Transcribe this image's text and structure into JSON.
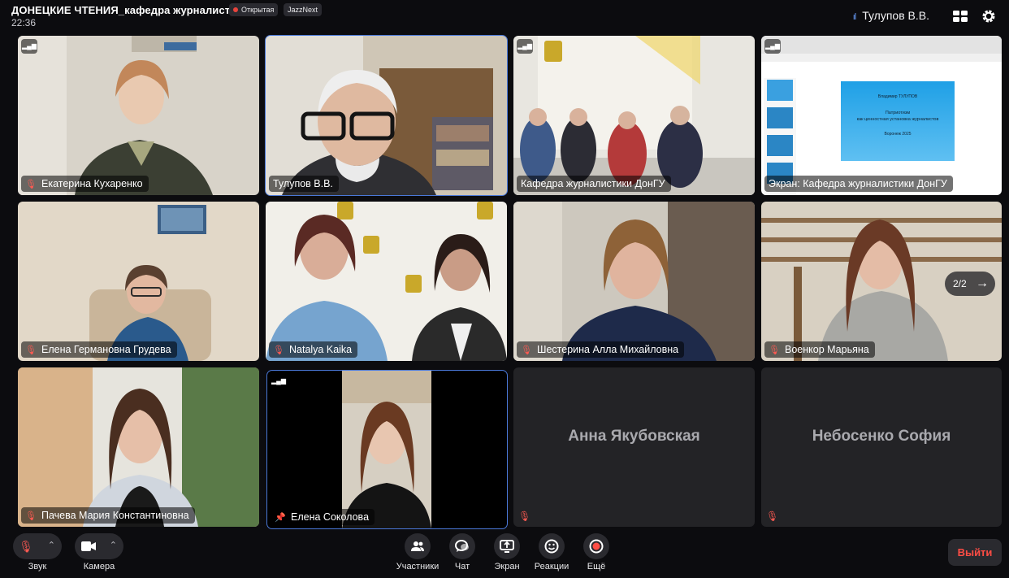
{
  "header": {
    "title": "ДОНЕЦКИЕ ЧТЕНИЯ_кафедра журналистики",
    "time": "22:36",
    "badges": {
      "open": "Открытая",
      "app": "JazzNext"
    },
    "user_name": "Тулупов В.В."
  },
  "tiles": {
    "kukharenko": "Екатерина Кухаренко",
    "tulupov": "Тулупов В.В.",
    "kafedra": "Кафедра журналистики ДонГУ",
    "screen": "Экран: Кафедра журналистики ДонГУ",
    "grudeva": "Елена Германовна Грудева",
    "kaika": "Natalya Kaika",
    "shesterina": "Шестерина Алла Михайловна",
    "voenkor": "Военкор Марьяна",
    "pacheva": "Пачева Мария Константиновна",
    "sokolova": "Елена Соколова",
    "yakubovskaya": "Анна Якубовская",
    "nebosenko": "Небосенко София"
  },
  "slide": {
    "author": "Владимир ТУЛУПОВ",
    "title1": "Патриотизм",
    "title2": "как ценностная установка журналистов",
    "city": "Воронеж 2025"
  },
  "pager": "2/2",
  "controls": {
    "sound": "Звук",
    "camera": "Камера",
    "participants": "Участники",
    "chat": "Чат",
    "screen": "Экран",
    "reactions": "Реакции",
    "more": "Ещё",
    "leave": "Выйти"
  },
  "colors": {
    "background": "#0c0c0f",
    "active_border": "#4a78d8",
    "mute_red": "#ff5a52",
    "leave_red": "#ff4d45"
  }
}
